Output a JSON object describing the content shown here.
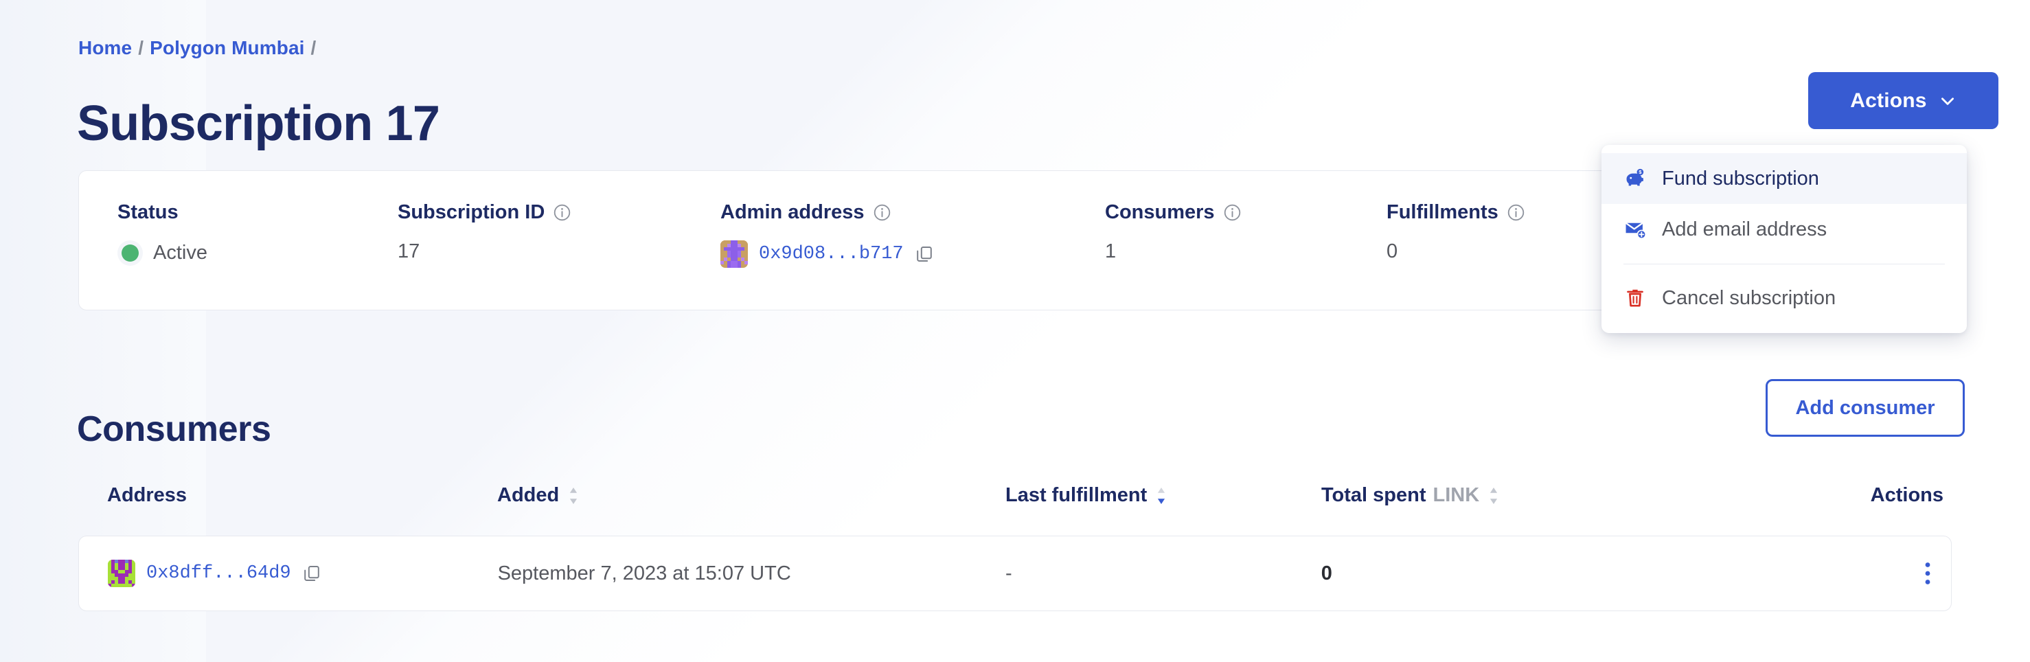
{
  "breadcrumb": {
    "items": [
      {
        "label": "Home",
        "type": "link"
      },
      {
        "label": "/",
        "type": "sep"
      },
      {
        "label": "Polygon Mumbai",
        "type": "link"
      },
      {
        "label": "/",
        "type": "sep"
      }
    ],
    "home": "Home",
    "network": "Polygon Mumbai",
    "sep": "/"
  },
  "page": {
    "title": "Subscription 17"
  },
  "actions": {
    "button_label": "Actions",
    "menu": [
      {
        "label": "Fund subscription",
        "icon": "piggy-bank-icon",
        "highlighted": true
      },
      {
        "label": "Add email address",
        "icon": "envelope-plus-icon",
        "highlighted": false
      },
      {
        "label": "Cancel subscription",
        "icon": "trash-icon",
        "highlighted": false,
        "danger": true
      }
    ]
  },
  "summary": {
    "status": {
      "label": "Status",
      "value": "Active",
      "color": "#4cb472",
      "has_info": false
    },
    "subscription_id": {
      "label": "Subscription ID",
      "value": "17",
      "has_info": true
    },
    "admin_address": {
      "label": "Admin address",
      "value": "0x9d08...b717",
      "has_info": true
    },
    "consumers": {
      "label": "Consumers",
      "value": "1",
      "has_info": true
    },
    "fulfillments": {
      "label": "Fulfillments",
      "value": "0",
      "has_info": true
    }
  },
  "consumers_section": {
    "title": "Consumers",
    "add_button": "Add consumer",
    "columns": [
      {
        "label": "Address",
        "sortable": false
      },
      {
        "label": "Added",
        "sortable": true,
        "sorted": false
      },
      {
        "label": "Last fulfillment",
        "sortable": true,
        "sorted": true,
        "direction": "desc"
      },
      {
        "label": "Total spent",
        "unit": "LINK",
        "sortable": true,
        "sorted": false
      },
      {
        "label": "Actions",
        "sortable": false
      }
    ],
    "column_labels": {
      "address": "Address",
      "added": "Added",
      "last_fulfillment": "Last fulfillment",
      "total_spent": "Total spent",
      "link_unit": "LINK",
      "actions": "Actions"
    },
    "rows": [
      {
        "address": "0x8dff...64d9",
        "added": "September 7, 2023 at 15:07 UTC",
        "last_fulfillment": "-",
        "total_spent": "0"
      }
    ]
  },
  "colors": {
    "primary": "#375bd2",
    "title": "#1d2a63",
    "text": "#56585f",
    "status_active": "#4cb472",
    "danger": "#d94040",
    "muted": "#a0a4ad"
  }
}
